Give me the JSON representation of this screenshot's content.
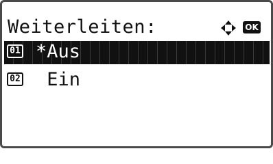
{
  "screen": {
    "title": "Weiterleiten:",
    "ok_key": "OK"
  },
  "options": [
    {
      "number": "01",
      "label": "*Aus",
      "selected": true
    },
    {
      "number": "02",
      "label": " Ein",
      "selected": false
    }
  ],
  "icons": {
    "navigation": "four-way-arrow-icon",
    "ok": "ok-key-icon"
  },
  "colors": {
    "highlight": "#111111",
    "text": "#111111",
    "background": "#ffffff"
  }
}
